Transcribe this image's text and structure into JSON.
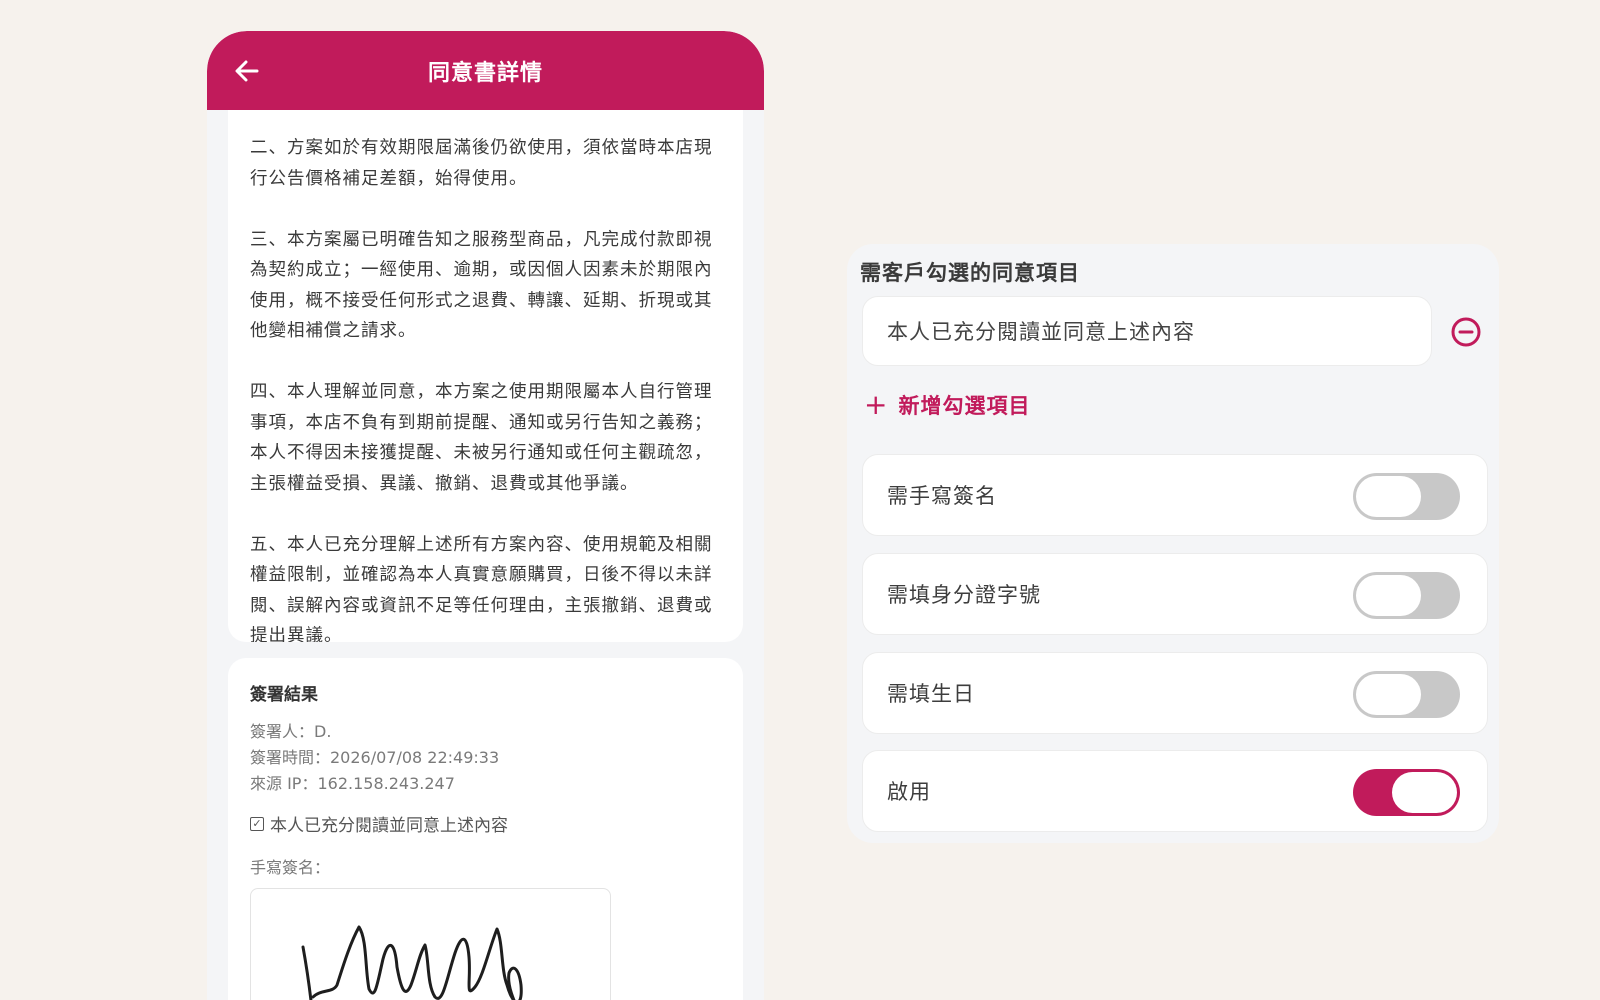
{
  "phone": {
    "title": "同意書詳情",
    "terms": [
      "二、方案如於有效期限屆滿後仍欲使用，須依當時本店現行公告價格補足差額，始得使用。",
      "三、本方案屬已明確告知之服務型商品，凡完成付款即視為契約成立；一經使用、逾期，或因個人因素未於期限內使用，概不接受任何形式之退費、轉讓、延期、折現或其他變相補償之請求。",
      "四、本人理解並同意，本方案之使用期限屬本人自行管理事項，本店不負有到期前提醒、通知或另行告知之義務；本人不得因未接獲提醒、未被另行通知或任何主觀疏忽，主張權益受損、異議、撤銷、退費或其他爭議。",
      "五、本人已充分理解上述所有方案內容、使用規範及相關權益限制，並確認為本人真實意願購買，日後不得以未詳閱、誤解內容或資訊不足等任何理由，主張撤銷、退費或提出異議。"
    ],
    "result": {
      "title": "簽署結果",
      "signer": "簽署人：D.",
      "time": "簽署時間：2026/07/08 22:49:33",
      "ip": "來源 IP：162.158.243.247",
      "consent": "本人已充分閱讀並同意上述內容",
      "signature_label": "手寫簽名："
    }
  },
  "panel": {
    "title": "需客戶勾選的同意項目",
    "consent_item": "本人已充分閱讀並同意上述內容",
    "add_label": "新增勾選項目",
    "toggles": [
      {
        "label": "需手寫簽名",
        "on": false
      },
      {
        "label": "需填身分證字號",
        "on": false
      },
      {
        "label": "需填生日",
        "on": false
      },
      {
        "label": "啟用",
        "on": true
      }
    ]
  },
  "colors": {
    "accent": "#c11b5b",
    "background": "#f6f2ed",
    "toggle_off": "#c8c8c8"
  }
}
